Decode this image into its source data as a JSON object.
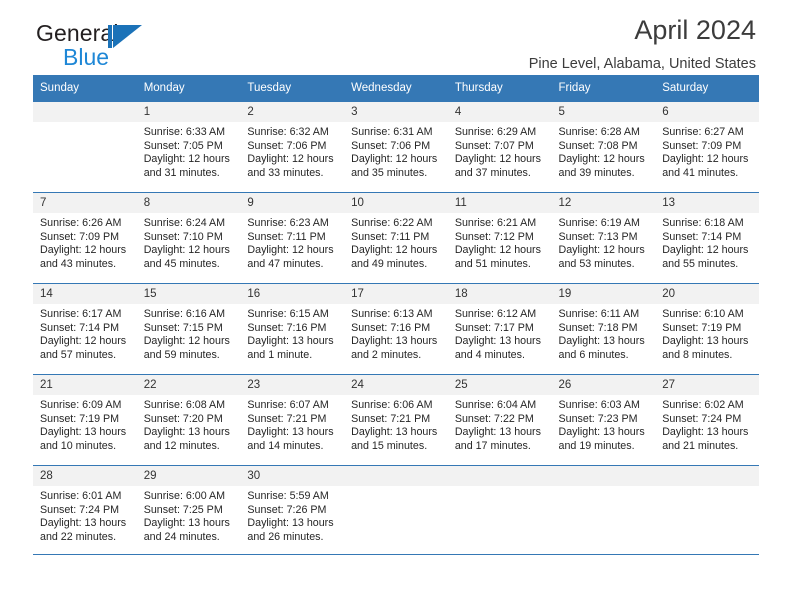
{
  "brand": {
    "word_one": "General",
    "word_two": "Blue",
    "mark": "triangle-logo"
  },
  "header": {
    "title": "April 2024",
    "subtitle": "Pine Level, Alabama, United States"
  },
  "colors": {
    "header_blue": "#3578b5",
    "brand_blue": "#1e87d6",
    "daynum_band": "#f2f2f2",
    "text": "#262626"
  },
  "weekdays": [
    "Sunday",
    "Monday",
    "Tuesday",
    "Wednesday",
    "Thursday",
    "Friday",
    "Saturday"
  ],
  "weeks": [
    [
      {
        "empty": true,
        "day": "",
        "sunrise": "",
        "sunset": "",
        "daylight1": "",
        "daylight2": ""
      },
      {
        "empty": false,
        "day": "1",
        "sunrise": "Sunrise: 6:33 AM",
        "sunset": "Sunset: 7:05 PM",
        "daylight1": "Daylight: 12 hours",
        "daylight2": "and 31 minutes."
      },
      {
        "empty": false,
        "day": "2",
        "sunrise": "Sunrise: 6:32 AM",
        "sunset": "Sunset: 7:06 PM",
        "daylight1": "Daylight: 12 hours",
        "daylight2": "and 33 minutes."
      },
      {
        "empty": false,
        "day": "3",
        "sunrise": "Sunrise: 6:31 AM",
        "sunset": "Sunset: 7:06 PM",
        "daylight1": "Daylight: 12 hours",
        "daylight2": "and 35 minutes."
      },
      {
        "empty": false,
        "day": "4",
        "sunrise": "Sunrise: 6:29 AM",
        "sunset": "Sunset: 7:07 PM",
        "daylight1": "Daylight: 12 hours",
        "daylight2": "and 37 minutes."
      },
      {
        "empty": false,
        "day": "5",
        "sunrise": "Sunrise: 6:28 AM",
        "sunset": "Sunset: 7:08 PM",
        "daylight1": "Daylight: 12 hours",
        "daylight2": "and 39 minutes."
      },
      {
        "empty": false,
        "day": "6",
        "sunrise": "Sunrise: 6:27 AM",
        "sunset": "Sunset: 7:09 PM",
        "daylight1": "Daylight: 12 hours",
        "daylight2": "and 41 minutes."
      }
    ],
    [
      {
        "empty": false,
        "day": "7",
        "sunrise": "Sunrise: 6:26 AM",
        "sunset": "Sunset: 7:09 PM",
        "daylight1": "Daylight: 12 hours",
        "daylight2": "and 43 minutes."
      },
      {
        "empty": false,
        "day": "8",
        "sunrise": "Sunrise: 6:24 AM",
        "sunset": "Sunset: 7:10 PM",
        "daylight1": "Daylight: 12 hours",
        "daylight2": "and 45 minutes."
      },
      {
        "empty": false,
        "day": "9",
        "sunrise": "Sunrise: 6:23 AM",
        "sunset": "Sunset: 7:11 PM",
        "daylight1": "Daylight: 12 hours",
        "daylight2": "and 47 minutes."
      },
      {
        "empty": false,
        "day": "10",
        "sunrise": "Sunrise: 6:22 AM",
        "sunset": "Sunset: 7:11 PM",
        "daylight1": "Daylight: 12 hours",
        "daylight2": "and 49 minutes."
      },
      {
        "empty": false,
        "day": "11",
        "sunrise": "Sunrise: 6:21 AM",
        "sunset": "Sunset: 7:12 PM",
        "daylight1": "Daylight: 12 hours",
        "daylight2": "and 51 minutes."
      },
      {
        "empty": false,
        "day": "12",
        "sunrise": "Sunrise: 6:19 AM",
        "sunset": "Sunset: 7:13 PM",
        "daylight1": "Daylight: 12 hours",
        "daylight2": "and 53 minutes."
      },
      {
        "empty": false,
        "day": "13",
        "sunrise": "Sunrise: 6:18 AM",
        "sunset": "Sunset: 7:14 PM",
        "daylight1": "Daylight: 12 hours",
        "daylight2": "and 55 minutes."
      }
    ],
    [
      {
        "empty": false,
        "day": "14",
        "sunrise": "Sunrise: 6:17 AM",
        "sunset": "Sunset: 7:14 PM",
        "daylight1": "Daylight: 12 hours",
        "daylight2": "and 57 minutes."
      },
      {
        "empty": false,
        "day": "15",
        "sunrise": "Sunrise: 6:16 AM",
        "sunset": "Sunset: 7:15 PM",
        "daylight1": "Daylight: 12 hours",
        "daylight2": "and 59 minutes."
      },
      {
        "empty": false,
        "day": "16",
        "sunrise": "Sunrise: 6:15 AM",
        "sunset": "Sunset: 7:16 PM",
        "daylight1": "Daylight: 13 hours",
        "daylight2": "and 1 minute."
      },
      {
        "empty": false,
        "day": "17",
        "sunrise": "Sunrise: 6:13 AM",
        "sunset": "Sunset: 7:16 PM",
        "daylight1": "Daylight: 13 hours",
        "daylight2": "and 2 minutes."
      },
      {
        "empty": false,
        "day": "18",
        "sunrise": "Sunrise: 6:12 AM",
        "sunset": "Sunset: 7:17 PM",
        "daylight1": "Daylight: 13 hours",
        "daylight2": "and 4 minutes."
      },
      {
        "empty": false,
        "day": "19",
        "sunrise": "Sunrise: 6:11 AM",
        "sunset": "Sunset: 7:18 PM",
        "daylight1": "Daylight: 13 hours",
        "daylight2": "and 6 minutes."
      },
      {
        "empty": false,
        "day": "20",
        "sunrise": "Sunrise: 6:10 AM",
        "sunset": "Sunset: 7:19 PM",
        "daylight1": "Daylight: 13 hours",
        "daylight2": "and 8 minutes."
      }
    ],
    [
      {
        "empty": false,
        "day": "21",
        "sunrise": "Sunrise: 6:09 AM",
        "sunset": "Sunset: 7:19 PM",
        "daylight1": "Daylight: 13 hours",
        "daylight2": "and 10 minutes."
      },
      {
        "empty": false,
        "day": "22",
        "sunrise": "Sunrise: 6:08 AM",
        "sunset": "Sunset: 7:20 PM",
        "daylight1": "Daylight: 13 hours",
        "daylight2": "and 12 minutes."
      },
      {
        "empty": false,
        "day": "23",
        "sunrise": "Sunrise: 6:07 AM",
        "sunset": "Sunset: 7:21 PM",
        "daylight1": "Daylight: 13 hours",
        "daylight2": "and 14 minutes."
      },
      {
        "empty": false,
        "day": "24",
        "sunrise": "Sunrise: 6:06 AM",
        "sunset": "Sunset: 7:21 PM",
        "daylight1": "Daylight: 13 hours",
        "daylight2": "and 15 minutes."
      },
      {
        "empty": false,
        "day": "25",
        "sunrise": "Sunrise: 6:04 AM",
        "sunset": "Sunset: 7:22 PM",
        "daylight1": "Daylight: 13 hours",
        "daylight2": "and 17 minutes."
      },
      {
        "empty": false,
        "day": "26",
        "sunrise": "Sunrise: 6:03 AM",
        "sunset": "Sunset: 7:23 PM",
        "daylight1": "Daylight: 13 hours",
        "daylight2": "and 19 minutes."
      },
      {
        "empty": false,
        "day": "27",
        "sunrise": "Sunrise: 6:02 AM",
        "sunset": "Sunset: 7:24 PM",
        "daylight1": "Daylight: 13 hours",
        "daylight2": "and 21 minutes."
      }
    ],
    [
      {
        "empty": false,
        "day": "28",
        "sunrise": "Sunrise: 6:01 AM",
        "sunset": "Sunset: 7:24 PM",
        "daylight1": "Daylight: 13 hours",
        "daylight2": "and 22 minutes."
      },
      {
        "empty": false,
        "day": "29",
        "sunrise": "Sunrise: 6:00 AM",
        "sunset": "Sunset: 7:25 PM",
        "daylight1": "Daylight: 13 hours",
        "daylight2": "and 24 minutes."
      },
      {
        "empty": false,
        "day": "30",
        "sunrise": "Sunrise: 5:59 AM",
        "sunset": "Sunset: 7:26 PM",
        "daylight1": "Daylight: 13 hours",
        "daylight2": "and 26 minutes."
      },
      {
        "empty": true,
        "day": "",
        "sunrise": "",
        "sunset": "",
        "daylight1": "",
        "daylight2": ""
      },
      {
        "empty": true,
        "day": "",
        "sunrise": "",
        "sunset": "",
        "daylight1": "",
        "daylight2": ""
      },
      {
        "empty": true,
        "day": "",
        "sunrise": "",
        "sunset": "",
        "daylight1": "",
        "daylight2": ""
      },
      {
        "empty": true,
        "day": "",
        "sunrise": "",
        "sunset": "",
        "daylight1": "",
        "daylight2": ""
      }
    ]
  ]
}
